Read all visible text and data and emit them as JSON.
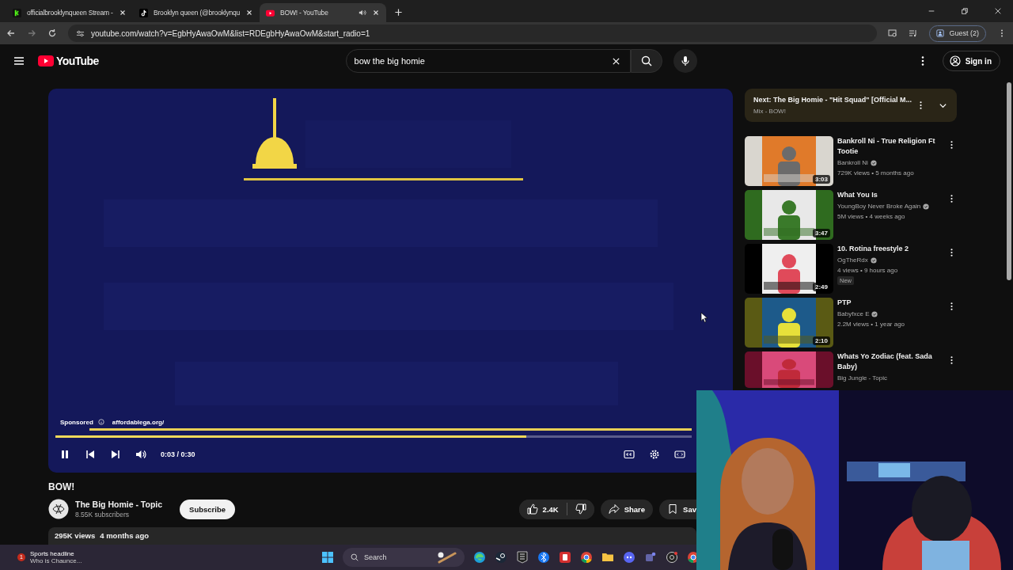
{
  "tabs": [
    {
      "title": "officialbrooklynqueen Stream -",
      "selected": false,
      "audio": false
    },
    {
      "title": "Brooklyn queen (@brooklynqu",
      "selected": false,
      "audio": false
    },
    {
      "title": "BOW! - YouTube",
      "selected": true,
      "audio": true
    }
  ],
  "address_bar": {
    "url": "youtube.com/watch?v=EgbHyAwaOwM&list=RDEgbHyAwaOwM&start_radio=1",
    "profile": "Guest (2)"
  },
  "header": {
    "logo": "YouTube",
    "search": "bow the big homie",
    "sign_in": "Sign in"
  },
  "player": {
    "sponsored": "Sponsored",
    "ad_link": "affordablega.org/",
    "time": "0:03 / 0:30",
    "playing": true,
    "progress": {
      "level": 0.74
    }
  },
  "video": {
    "title": "BOW!",
    "channel": "The Big Homie - Topic",
    "subscribers": "8.55K subscribers",
    "subscribe": "Subscribe",
    "likes": "2.4K",
    "share": "Share",
    "save": "Sav",
    "views": "295K views",
    "date": "4 months ago"
  },
  "up_next": {
    "title": "Next: The Big Homie - \"Hit Squad\" [Official M...",
    "playlist": "Mix - BOW!"
  },
  "videos": [
    {
      "title": "Bankroll Ni - True Religion Ft Tootie",
      "channel": "Bankroll Ni",
      "verified": true,
      "meta": "729K views • 5 months ago",
      "duration": "3:03"
    },
    {
      "title": "What You Is",
      "channel": "YoungBoy Never Broke Again",
      "verified": true,
      "meta": "5M views • 4 weeks ago",
      "duration": "3:47"
    },
    {
      "title": "10. Rotina freestyle 2",
      "channel": "OgTheRdx",
      "verified": true,
      "meta": "4 views • 9 hours ago",
      "duration": "2:49",
      "badge": "New"
    },
    {
      "title": "PTP",
      "channel": "Babyfxce E",
      "verified": true,
      "meta": "2.2M views • 1 year ago",
      "duration": "2:10"
    },
    {
      "title": "Whats Yo Zodiac (feat. Sada Baby)",
      "channel": "Big Jungle - Topic",
      "verified": false
    }
  ],
  "taskbar": {
    "news_count": "1",
    "news_title": "Sports headline",
    "news_text": "Who is Chaunce...",
    "search": "Search"
  }
}
